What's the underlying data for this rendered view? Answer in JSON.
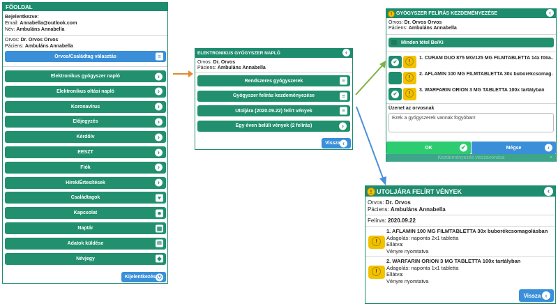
{
  "panel1": {
    "title": "FŐOLDAL",
    "logged_in_label": "Bejelentkezve:",
    "email_label": "Email:",
    "email": "Annabella@outlook.com",
    "name_label": "Név:",
    "name": "Ambuláns Annabella",
    "doctor_label": "Orvos:",
    "doctor": "Dr. Orvos Orvos",
    "patient_label": "Páciens:",
    "patient": "Ambuláns Annabella",
    "select_button": "Orvos/Családtag választás",
    "menu": [
      "Elektronikus gyógyszer napló",
      "Elektronikus oltási napló",
      "Koronavírus",
      "Előjegyzés",
      "Kérdőív",
      "EESZT",
      "Fiók",
      "Hírek/Értesítések",
      "Családtagok",
      "Kapcsolat",
      "Naptár",
      "Adatok küldése",
      "Névjegy"
    ],
    "logout": "Kijelentkezés"
  },
  "panel2": {
    "title": "ELEKTRONIKUS GYÓGYSZER NAPLÓ",
    "doctor_label": "Orvos:",
    "doctor": "Dr. Orvos",
    "patient_label": "Páciens:",
    "patient": "Ambuláns Annabella",
    "items": [
      "Rendszeres gyógyszerek",
      "Gyógyszer felírás kezdeményezése",
      "Utoljára (2020.09.22) felírt vények",
      "Egy éven belüli vények (2 felírás)"
    ],
    "back": "Vissza"
  },
  "panel3": {
    "title": "GYÓGYSZER FELÍRÁS KEZDEMÉNYEZÉSE",
    "doctor_label": "Orvos:",
    "doctor": "Dr. Orvos Orvos",
    "patient_label": "Páciens:",
    "patient": "Ambuláns Annabella",
    "all_toggle": "Minden tétel Be/Ki",
    "drugs": [
      "1. CURAM DUO 875 MG/125 MG FILMTABLETTA 14x fólia...",
      "2. AFLAMIN 100 MG FILMTABLETTA 30x buborékcsomag...",
      "3. WARFARIN ORION 3 MG TABLETTA 100x tartályban"
    ],
    "message_label": "Üzenet az orvosnak",
    "message": "Ezek a gyógyszerek vannak fogyóban!",
    "ok": "OK",
    "cancel": "Mégse",
    "reminder": "Kezdeményezés visszavonása"
  },
  "panel4": {
    "title": "UTOLJÁRA FELÍRT VÉNYEK",
    "doctor_label": "Orvos:",
    "doctor": "Dr. Orvos",
    "patient_label": "Páciens:",
    "patient": "Ambuláns Annabella",
    "date_label": "Felírva:",
    "date": "2020.09.22",
    "drugs": [
      {
        "name": "1. AFLAMIN 100 MG FILMTABLETTA 30x buborékcsomagolásban",
        "dose": "Adagolás: naponta 2x1 tabletta",
        "supply": "Ellátva:",
        "status": "Vényre nyomtatva"
      },
      {
        "name": "2. WARFARIN ORION 3 MG TABLETTA 100x tartályban",
        "dose": "Adagolás: naponta 1x1 tabletta",
        "supply": "Ellátva:",
        "status": "Vényre nyomtatva"
      }
    ],
    "back": "Vissza"
  },
  "icons": {
    "chevron": "›",
    "back": "‹",
    "list": "≡",
    "check": "✔",
    "warn": "!",
    "close": "×"
  },
  "colors": {
    "primary": "#1e8c6e",
    "blue": "#3a8fd8",
    "ok": "#2ecc71",
    "warning": "#f2c200"
  }
}
